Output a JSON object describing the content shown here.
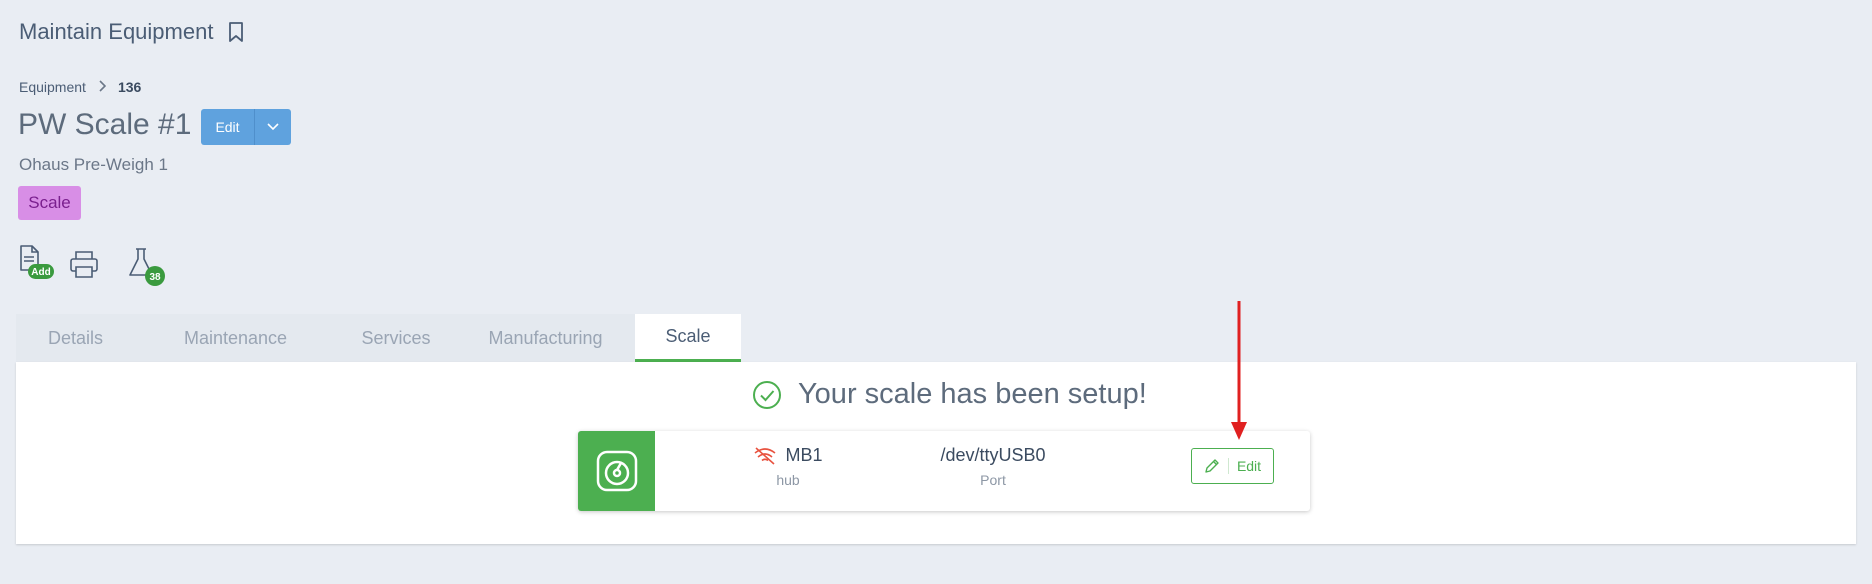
{
  "header": {
    "title": "Maintain Equipment"
  },
  "breadcrumb": {
    "parent": "Equipment",
    "current": "136"
  },
  "equipment": {
    "name": "PW Scale #1",
    "edit_label": "Edit",
    "model": "Ohaus Pre-Weigh 1",
    "type_badge": "Scale"
  },
  "actions": {
    "add_badge": "Add",
    "tests_count": "38"
  },
  "tabs": [
    {
      "label": "Details"
    },
    {
      "label": "Maintenance"
    },
    {
      "label": "Services"
    },
    {
      "label": "Manufacturing"
    },
    {
      "label": "Scale",
      "active": true
    }
  ],
  "scale_panel": {
    "status_message": "Your scale has been setup!",
    "hub_value": "MB1",
    "hub_label": "hub",
    "port_value": "/dev/ttyUSB0",
    "port_label": "Port",
    "edit_label": "Edit"
  },
  "colors": {
    "accent_green": "#4caf50",
    "primary_blue": "#5fa2de",
    "badge_purple": "#d88ee6",
    "arrow_red": "#e02020",
    "wifi_off_red": "#e8523f"
  }
}
